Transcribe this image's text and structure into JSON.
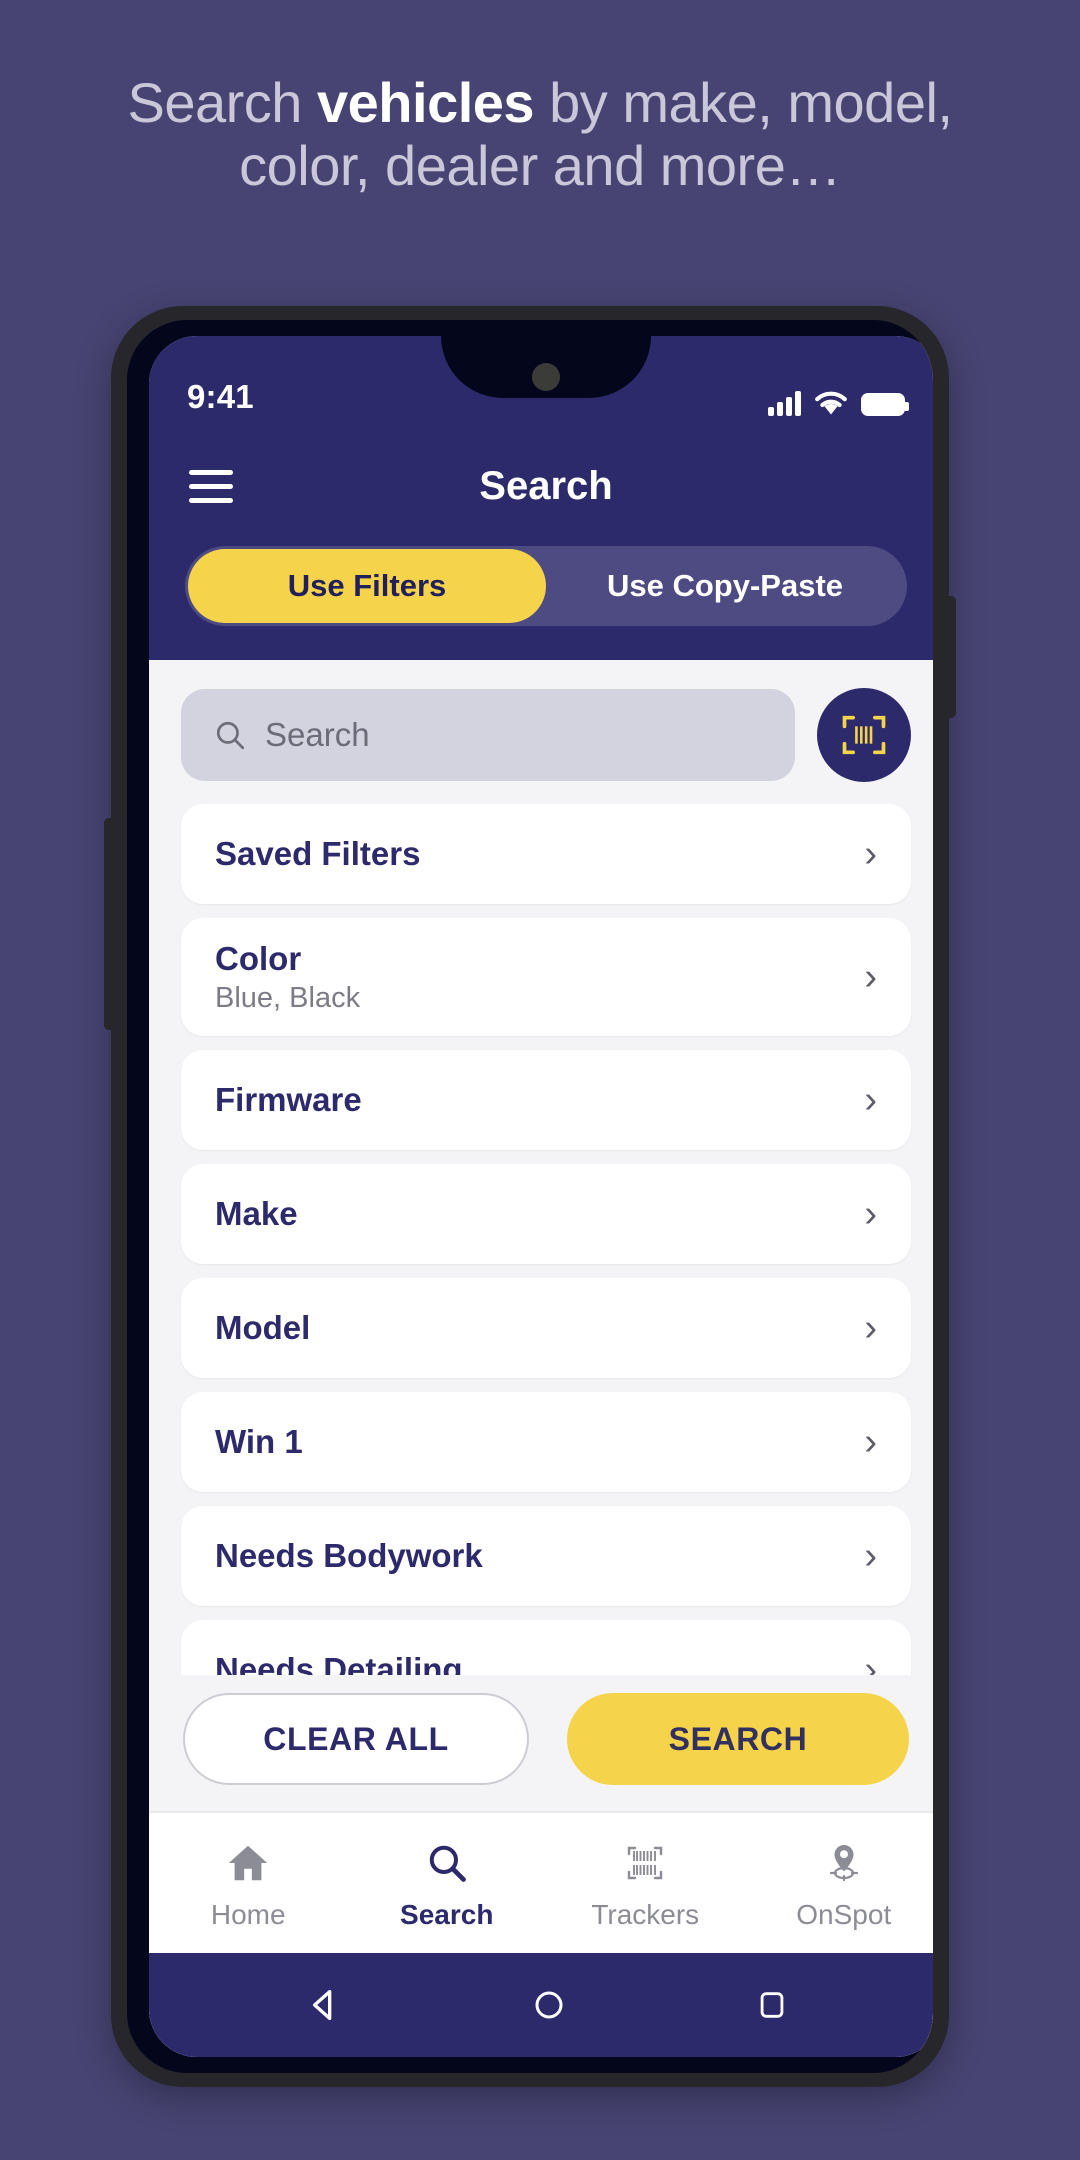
{
  "promo": {
    "line1_prefix": "Search ",
    "line1_bold": "vehicles",
    "line1_suffix": " by make, model,",
    "line2": "color, dealer and more…"
  },
  "status_bar": {
    "time": "9:41",
    "signal_icon": "cellular-signal-icon",
    "wifi_icon": "wifi-icon",
    "battery_icon": "battery-full-icon"
  },
  "app_bar": {
    "menu_icon": "hamburger-menu-icon",
    "title": "Search"
  },
  "tabs": [
    {
      "label": "Use Filters",
      "active": true
    },
    {
      "label": "Use Copy-Paste",
      "active": false
    }
  ],
  "search": {
    "placeholder": "Search",
    "value": "",
    "search_icon": "search-icon",
    "scan_icon": "barcode-scan-icon"
  },
  "filters": [
    {
      "label": "Saved Filters",
      "value": ""
    },
    {
      "label": "Color",
      "value": "Blue, Black"
    },
    {
      "label": "Firmware",
      "value": ""
    },
    {
      "label": "Make",
      "value": ""
    },
    {
      "label": "Model",
      "value": ""
    },
    {
      "label": "Win 1",
      "value": ""
    },
    {
      "label": "Needs Bodywork",
      "value": ""
    },
    {
      "label": "Needs Detailing",
      "value": ""
    }
  ],
  "actions": {
    "clear_label": "CLEAR ALL",
    "search_label": "SEARCH"
  },
  "bottom_nav": [
    {
      "label": "Home",
      "icon": "home-icon",
      "active": false
    },
    {
      "label": "Search",
      "icon": "search-icon",
      "active": true
    },
    {
      "label": "Trackers",
      "icon": "barcode-icon",
      "active": false
    },
    {
      "label": "OnSpot",
      "icon": "location-pin-icon",
      "active": false
    }
  ],
  "system_nav": {
    "back_icon": "back-triangle-icon",
    "home_icon": "home-circle-icon",
    "recents_icon": "recents-square-icon"
  },
  "colors": {
    "background": "#474473",
    "brand_navy": "#2c2a6b",
    "accent_yellow": "#f5d44b",
    "screen_bg": "#f4f4f6",
    "card_white": "#ffffff",
    "tab_track": "#4e4b82",
    "search_field": "#d3d2df"
  }
}
